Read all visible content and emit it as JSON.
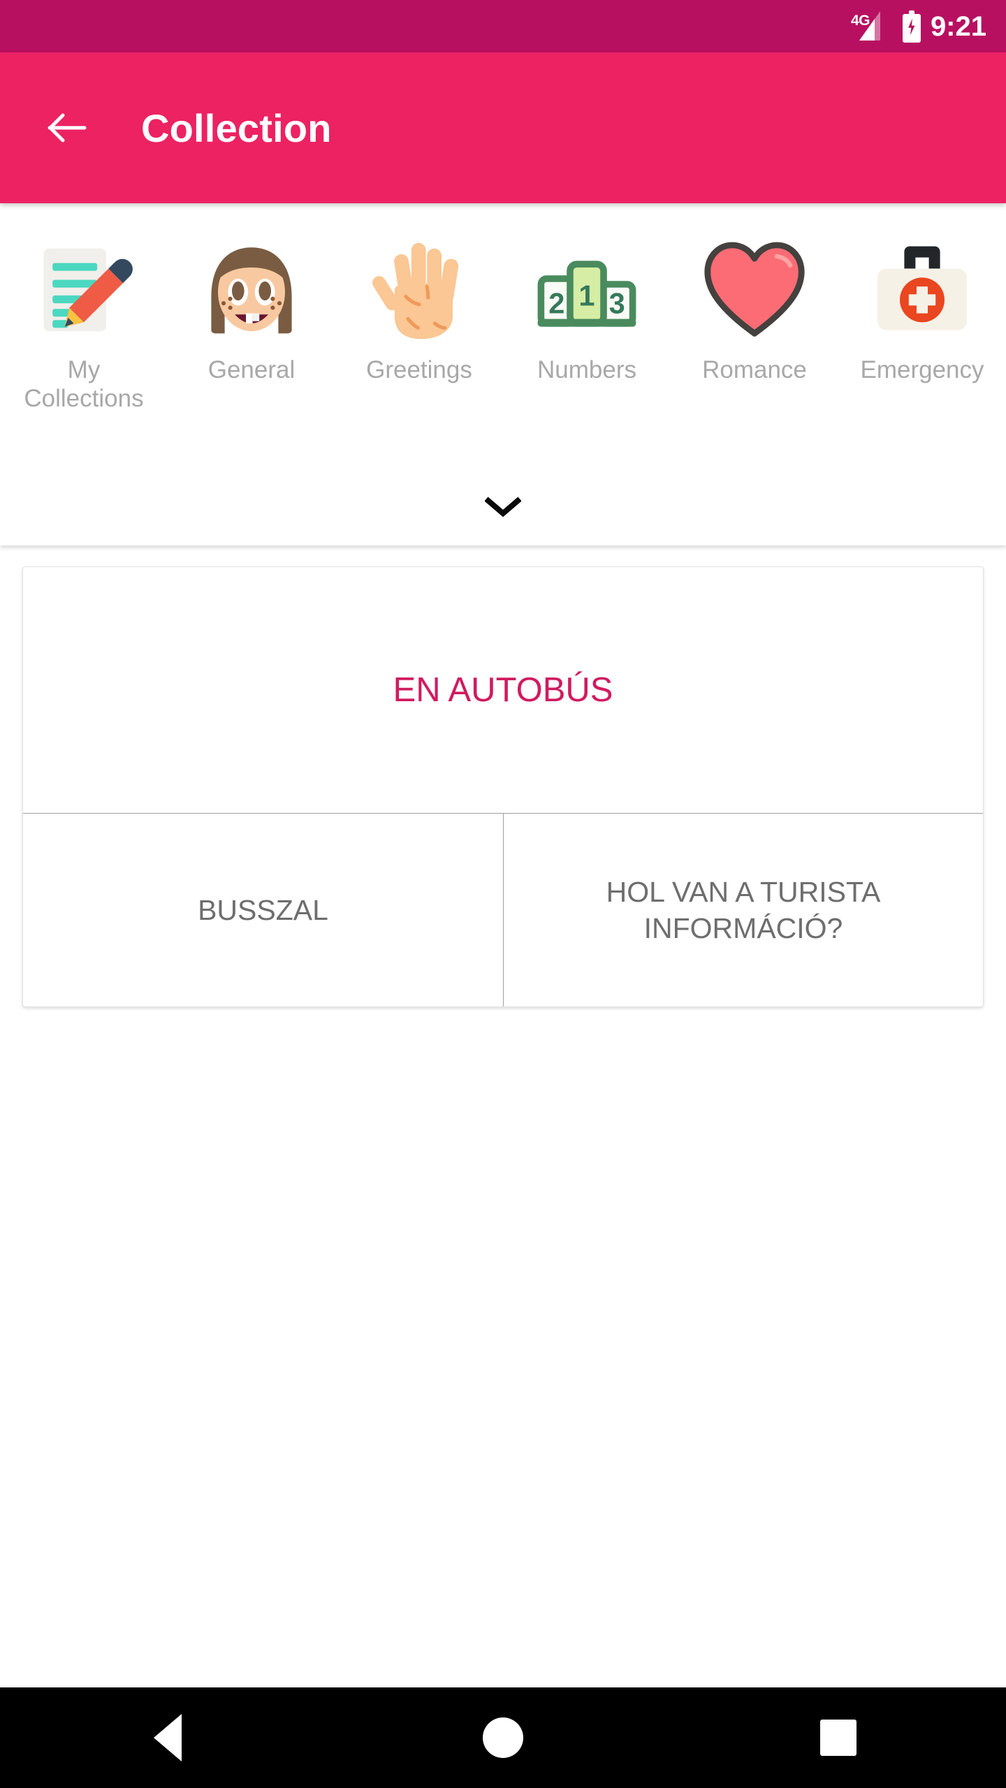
{
  "status_bar": {
    "network_label": "4G",
    "time": "9:21",
    "battery_state": "charging",
    "background_color": "#B81060"
  },
  "app_bar": {
    "title": "Collection",
    "back_icon": "arrow-left-icon",
    "background_color": "#EC2262",
    "text_color": "#FFFFFF"
  },
  "categories": {
    "expand_icon": "chevron-down-icon",
    "label_color": "#A8A8A8",
    "items": [
      {
        "label": "My Collections",
        "icon": "memo-pencil-icon"
      },
      {
        "label": "General",
        "icon": "girl-face-icon"
      },
      {
        "label": "Greetings",
        "icon": "raised-hand-icon"
      },
      {
        "label": "Numbers",
        "icon": "podium-123-icon"
      },
      {
        "label": "Romance",
        "icon": "heart-icon"
      },
      {
        "label": "Emergency",
        "icon": "first-aid-kit-icon"
      }
    ]
  },
  "phrase_card": {
    "headline": "EN AUTOBÚS",
    "headline_color": "#D01B60",
    "left_cell": "BUSSZAL",
    "right_cell": "HOL VAN A TURISTA INFORMÁCIÓ?",
    "cell_text_color": "#6E6E6E"
  },
  "nav_bar": {
    "back": "triangle-back-icon",
    "home": "circle-home-icon",
    "recents": "square-recents-icon"
  }
}
